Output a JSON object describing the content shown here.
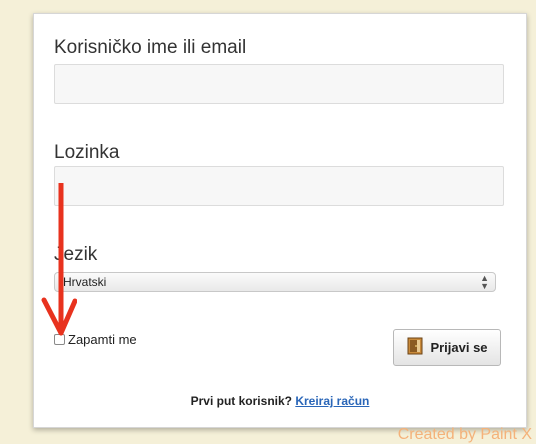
{
  "form": {
    "username_label": "Korisničko ime ili email",
    "username_value": "",
    "password_label": "Lozinka",
    "password_value": "",
    "language_label": "Jezik",
    "language_selected": "Hrvatski",
    "remember_label": "Zapamti me",
    "remember_checked": false,
    "login_label": "Prijavi se",
    "login_icon": "door-icon"
  },
  "footer": {
    "prompt": "Prvi put korisnik?",
    "link_label": "Kreiraj račun"
  },
  "annotation": {
    "arrow_icon": "red-arrow-down-icon",
    "arrow_color": "#e8321e"
  },
  "watermark": "Created by Paint X",
  "colors": {
    "background": "#f5f0d8",
    "link": "#2a66b8",
    "watermark": "#f4b27a"
  }
}
